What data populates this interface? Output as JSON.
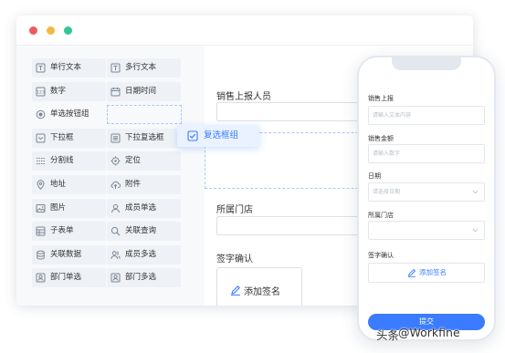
{
  "window": {
    "traffic_lights": [
      {
        "name": "close",
        "color": "#ef5b5b"
      },
      {
        "name": "minimize",
        "color": "#f4b942"
      },
      {
        "name": "maximize",
        "color": "#34c49a"
      }
    ]
  },
  "palette": {
    "items": [
      {
        "id": "single-line-text",
        "label": "单行文本",
        "icon": "text-box-icon"
      },
      {
        "id": "multi-line-text",
        "label": "多行文本",
        "icon": "text-box-icon"
      },
      {
        "id": "number",
        "label": "数字",
        "icon": "number-icon"
      },
      {
        "id": "datetime",
        "label": "日期时间",
        "icon": "calendar-icon"
      },
      {
        "id": "radio-group",
        "label": "单选按钮组",
        "icon": "radio-icon"
      },
      {
        "id": "dropdown",
        "label": "下拉框",
        "icon": "dropdown-icon"
      },
      {
        "id": "dropdown-multi",
        "label": "下拉复选框",
        "icon": "list-icon"
      },
      {
        "id": "divider",
        "label": "分割线",
        "icon": "divider-icon"
      },
      {
        "id": "location",
        "label": "定位",
        "icon": "locate-icon"
      },
      {
        "id": "address",
        "label": "地址",
        "icon": "map-pin-icon"
      },
      {
        "id": "attachment",
        "label": "附件",
        "icon": "cloud-upload-icon"
      },
      {
        "id": "image",
        "label": "图片",
        "icon": "image-icon"
      },
      {
        "id": "member-single",
        "label": "成员单选",
        "icon": "user-icon"
      },
      {
        "id": "subform",
        "label": "子表单",
        "icon": "table-icon"
      },
      {
        "id": "linked-query",
        "label": "关联查询",
        "icon": "link-search-icon"
      },
      {
        "id": "linked-data",
        "label": "关联数据",
        "icon": "database-icon"
      },
      {
        "id": "member-multi",
        "label": "成员多选",
        "icon": "users-icon"
      },
      {
        "id": "dept-single",
        "label": "部门单选",
        "icon": "department-icon"
      },
      {
        "id": "dept-multi",
        "label": "部门多选",
        "icon": "department-icon"
      }
    ],
    "dragging": {
      "label": "复选框组",
      "icon": "checkbox-icon"
    }
  },
  "canvas": {
    "fields": [
      {
        "label": "销售上报人员"
      },
      {
        "label": "所属门店"
      },
      {
        "label": "签字确认",
        "button": "添加签名"
      }
    ]
  },
  "phone": {
    "fields": [
      {
        "label": "销售上报",
        "placeholder": "请输入文本内容"
      },
      {
        "label": "销售金额",
        "placeholder": "请输入数字"
      },
      {
        "label": "日期",
        "placeholder": "请选择日期"
      },
      {
        "label": "所属门店",
        "placeholder": ""
      },
      {
        "label": "签字确认",
        "button": "添加签名"
      }
    ],
    "submit": "提交"
  },
  "watermark": {
    "prefix": "头条",
    "handle": "@Workfine"
  },
  "colors": {
    "accent": "#3a7bff",
    "palette_item_bg": "#eef1f5",
    "dashed_border": "#a9c7ff"
  }
}
